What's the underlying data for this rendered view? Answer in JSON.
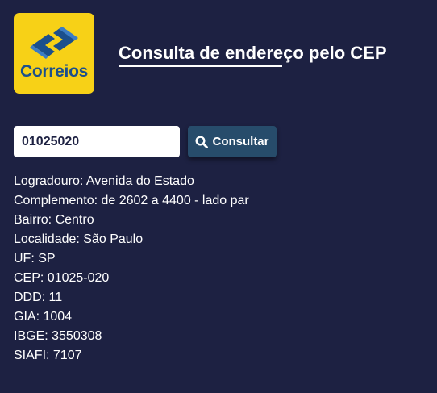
{
  "header": {
    "logo_text": "Correios",
    "title": "Consulta de endereço pelo CEP"
  },
  "search": {
    "value": "01025020",
    "button_label": "Consultar",
    "button_icon": "search-icon"
  },
  "results": {
    "logradouro": "Logradouro: Avenida do Estado",
    "complemento": "Complemento: de 2602 a 4400 - lado par",
    "bairro": "Bairro: Centro",
    "localidade": "Localidade: São Paulo",
    "uf": "UF: SP",
    "cep": "CEP: 01025-020",
    "ddd": "DDD: 11",
    "gia": "GIA: 1004",
    "ibge": "IBGE: 3550308",
    "siafi": "SIAFI: 7107"
  },
  "colors": {
    "background": "#1d2142",
    "logo_yellow": "#f7d117",
    "logo_blue": "#1b4f8c",
    "button": "#274c6b"
  }
}
